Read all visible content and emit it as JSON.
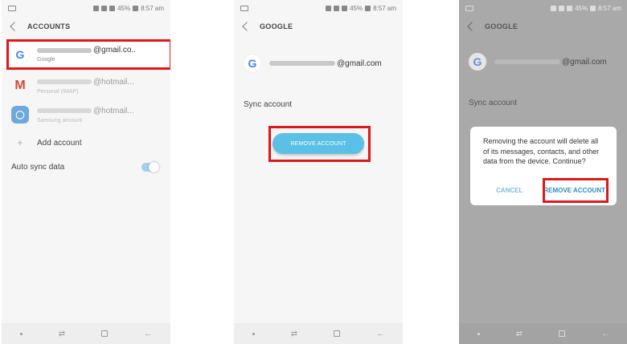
{
  "screen1": {
    "status": {
      "battery": "45%",
      "time": "8:57 am"
    },
    "title": "ACCOUNTS",
    "accounts": [
      {
        "suffix": "@gmail.co..",
        "sub": "Google"
      },
      {
        "suffix": "@hotmail...",
        "sub": "Personal (IMAP)"
      },
      {
        "suffix": "@hotmail...",
        "sub": "Samsung account"
      }
    ],
    "add_account": "Add account",
    "auto_sync": "Auto sync data"
  },
  "screen2": {
    "status": {
      "battery": "45%",
      "time": "8:57 am"
    },
    "title": "GOOGLE",
    "account_suffix": "@gmail.com",
    "sync_label": "Sync account",
    "remove_button": "REMOVE ACCOUNT"
  },
  "screen3": {
    "status": {
      "battery": "45%",
      "time": "8:57 am"
    },
    "title": "GOOGLE",
    "account_suffix": "@gmail.com",
    "sync_label": "Sync account",
    "dialog_message": "Removing the account will delete all of its messages, contacts, and other data from the device. Continue?",
    "cancel": "CANCEL",
    "remove_confirm": "REMOVE ACCOUNT"
  },
  "colors": {
    "highlight": "#e01818",
    "accent": "#5bc0e6"
  },
  "icons": [
    "google-icon",
    "gmail-icon",
    "samsung-account-icon",
    "plus-icon",
    "back-chevron-icon"
  ]
}
